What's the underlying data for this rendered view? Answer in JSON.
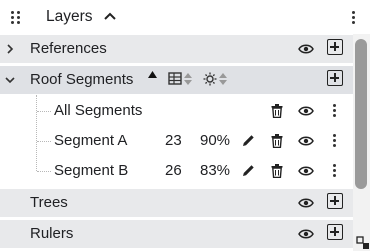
{
  "header": {
    "title": "Layers",
    "collapse_icon": "chevron-up-icon",
    "menu_icon": "kebab-menu-icon",
    "drag_icon": "drag-handle-icon"
  },
  "layers": [
    {
      "id": "references",
      "label": "References",
      "expanded": false
    },
    {
      "id": "roof-segments",
      "label": "Roof Segments",
      "expanded": true,
      "sort_icons": [
        "sort-asc-icon",
        "table-sort-icon",
        "sun-sort-icon"
      ],
      "children": [
        {
          "label": "All Segments"
        },
        {
          "label": "Segment A",
          "count": "23",
          "percent": "90%"
        },
        {
          "label": "Segment B",
          "count": "26",
          "percent": "83%"
        }
      ]
    },
    {
      "id": "trees",
      "label": "Trees"
    },
    {
      "id": "rulers",
      "label": "Rulers"
    }
  ],
  "icons": {
    "visibility": "eye-icon",
    "add": "add-box-icon",
    "delete": "trash-icon",
    "edit": "pencil-icon",
    "more": "kebab-menu-icon",
    "expand": "chevron-right-icon",
    "collapse": "chevron-down-icon"
  },
  "colors": {
    "row_bg": "#e8e9eb",
    "selected_bg": "#dfe1e5",
    "scrollbar": "#9a9a9a"
  }
}
